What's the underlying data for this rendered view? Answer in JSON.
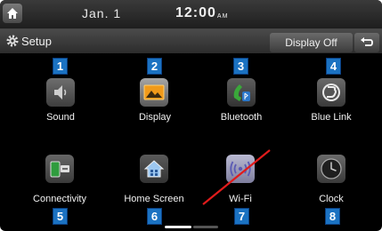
{
  "status_bar": {
    "date": "Jan. 1",
    "time": "12:00",
    "ampm": "AM"
  },
  "header": {
    "title": "Setup",
    "display_off_label": "Display Off"
  },
  "menu": {
    "items": [
      {
        "number": "1",
        "label": "Sound",
        "icon": "speaker-icon"
      },
      {
        "number": "2",
        "label": "Display",
        "icon": "display-icon"
      },
      {
        "number": "3",
        "label": "Bluetooth",
        "icon": "bluetooth-phone-icon"
      },
      {
        "number": "4",
        "label": "Blue Link",
        "icon": "blue-link-icon"
      },
      {
        "number": "5",
        "label": "Connectivity",
        "icon": "phone-connectivity-icon"
      },
      {
        "number": "6",
        "label": "Home Screen",
        "icon": "home-screen-icon"
      },
      {
        "number": "7",
        "label": "Wi-Fi",
        "icon": "wifi-icon",
        "crossed_out": true
      },
      {
        "number": "8",
        "label": "Clock",
        "icon": "clock-icon"
      }
    ]
  },
  "pagination": {
    "page": 1,
    "pages": 2
  },
  "colors": {
    "number_box": "#1b72c2",
    "strike_line": "#e11b1b",
    "background": "#000000"
  }
}
